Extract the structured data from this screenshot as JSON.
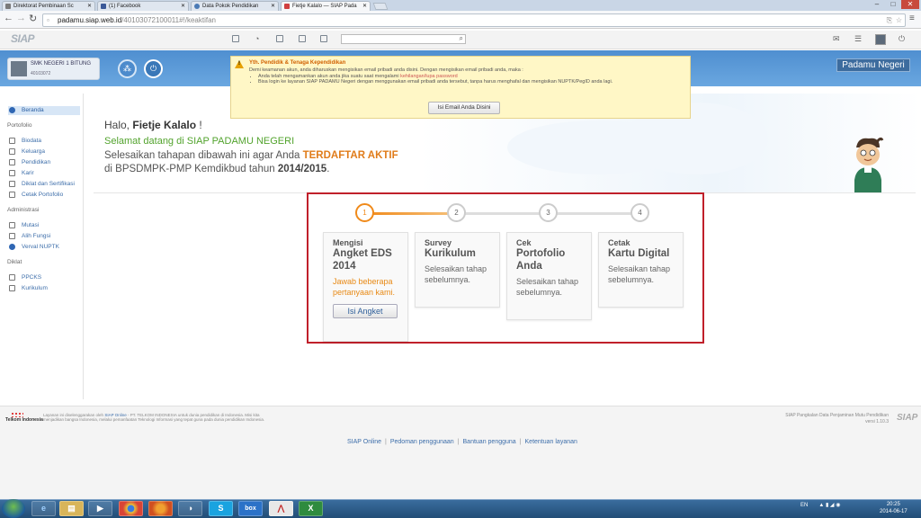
{
  "browser": {
    "tabs": [
      {
        "label": "Direktorat Pembinaan Sc",
        "favicon_color": "#7a7a7a"
      },
      {
        "label": "(1) Facebook",
        "favicon_color": "#3b5998"
      },
      {
        "label": "Data Pokok Pendidikan",
        "favicon_color": "#4a7ab5"
      },
      {
        "label": "Fietje Kalalo — SIAP Pada",
        "favicon_color": "#d04040"
      }
    ],
    "url": "padamu.siap.web.id",
    "url_path": "/40103072100011#!/keaktifan"
  },
  "app": {
    "logo": "SIAP",
    "banner_title": "Padamu Negeri",
    "school_name": "SMK NEGERI 1 BITUNG",
    "school_id": "40103072"
  },
  "alert": {
    "title": "Yth. Pendidik & Tenaga Kependidikan",
    "line1": "Demi keamanan akun, anda diharuskan mengisikan email pribadi anda disini. Dengan mengisikan email pribadi anda, maka :",
    "bullet1_pre": "Anda telah mengamankan akun anda jika suatu saat mengalami ",
    "bullet1_link": "kehilangan/lupa password",
    "bullet2": "Bisa login ke layanan SIAP PADAMU Negeri dengan menggunakan email pribadi anda tersebut, tanpa harus menghafal dan mengisikan NUPTK/PegID anda lagi.",
    "button": "Isi Email Anda Disini"
  },
  "sidebar": {
    "top": [
      {
        "label": "Beranda"
      }
    ],
    "groups": [
      {
        "header": "Portofolio",
        "items": [
          "Biodata",
          "Keluarga",
          "Pendidikan",
          "Karir",
          "Diklat dan Sertifikasi",
          "Cetak Portofolio"
        ]
      },
      {
        "header": "Administrasi",
        "items": [
          "Mutasi",
          "Alih Fungsi",
          "Verval NUPTK"
        ]
      },
      {
        "header": "Diklat",
        "items": [
          "PPCKS",
          "Kurikulum"
        ]
      }
    ]
  },
  "hero": {
    "hello_prefix": "Halo, ",
    "user_name": "Fietje Kalalo",
    "hello_suffix": " !",
    "welcome": "Selamat datang di SIAP PADAMU NEGERI",
    "instr_prefix": "Selesaikan tahapan dibawah ini agar Anda ",
    "instr_highlight": "TERDAFTAR AKTIF",
    "instr2_prefix": "di BPSDMPK-PMP Kemdikbud tahun ",
    "instr2_year": "2014/2015",
    "instr2_suffix": "."
  },
  "steps": [
    {
      "num": "1",
      "line1": "Mengisi",
      "line2": "Angket EDS 2014",
      "desc": "Jawab beberapa pertanyaan kami.",
      "button": "Isi Angket",
      "active": true
    },
    {
      "num": "2",
      "line1": "Survey",
      "line2": "Kurikulum",
      "desc": "Selesaikan tahap sebelumnya.",
      "active": false
    },
    {
      "num": "3",
      "line1": "Cek",
      "line2": "Portofolio Anda",
      "desc": "Selesaikan tahap sebelumnya.",
      "active": false
    },
    {
      "num": "4",
      "line1": "Cetak",
      "line2": "Kartu Digital",
      "desc": "Selesaikan tahap sebelumnya.",
      "active": false
    }
  ],
  "footer": {
    "telkom": "Telkom Indonesia",
    "text_pre": "Layanan ini diselenggarakan oleh ",
    "text_link": "SIAP Online",
    "text_post": " - PT. TELKOM INDONESIA untuk dunia pendidikan di Indonesia. Misi kita menjadikan bangsa Indonesia, melalui pemanfaatan Teknologi Informasi yang tepat guna pada dunia pendidikan Indonesia.",
    "right_line1": "SIAP Pangkalan Data Penjaminan Mutu Pendidikan",
    "right_line2": "versi 1.10.3",
    "logo": "SIAP",
    "links": [
      "SIAP Online",
      "Pedoman penggunaan",
      "Bantuan pengguna",
      "Ketentuan layanan"
    ]
  },
  "taskbar": {
    "lang": "EN",
    "time": "20:25",
    "date": "2014-06-17"
  }
}
